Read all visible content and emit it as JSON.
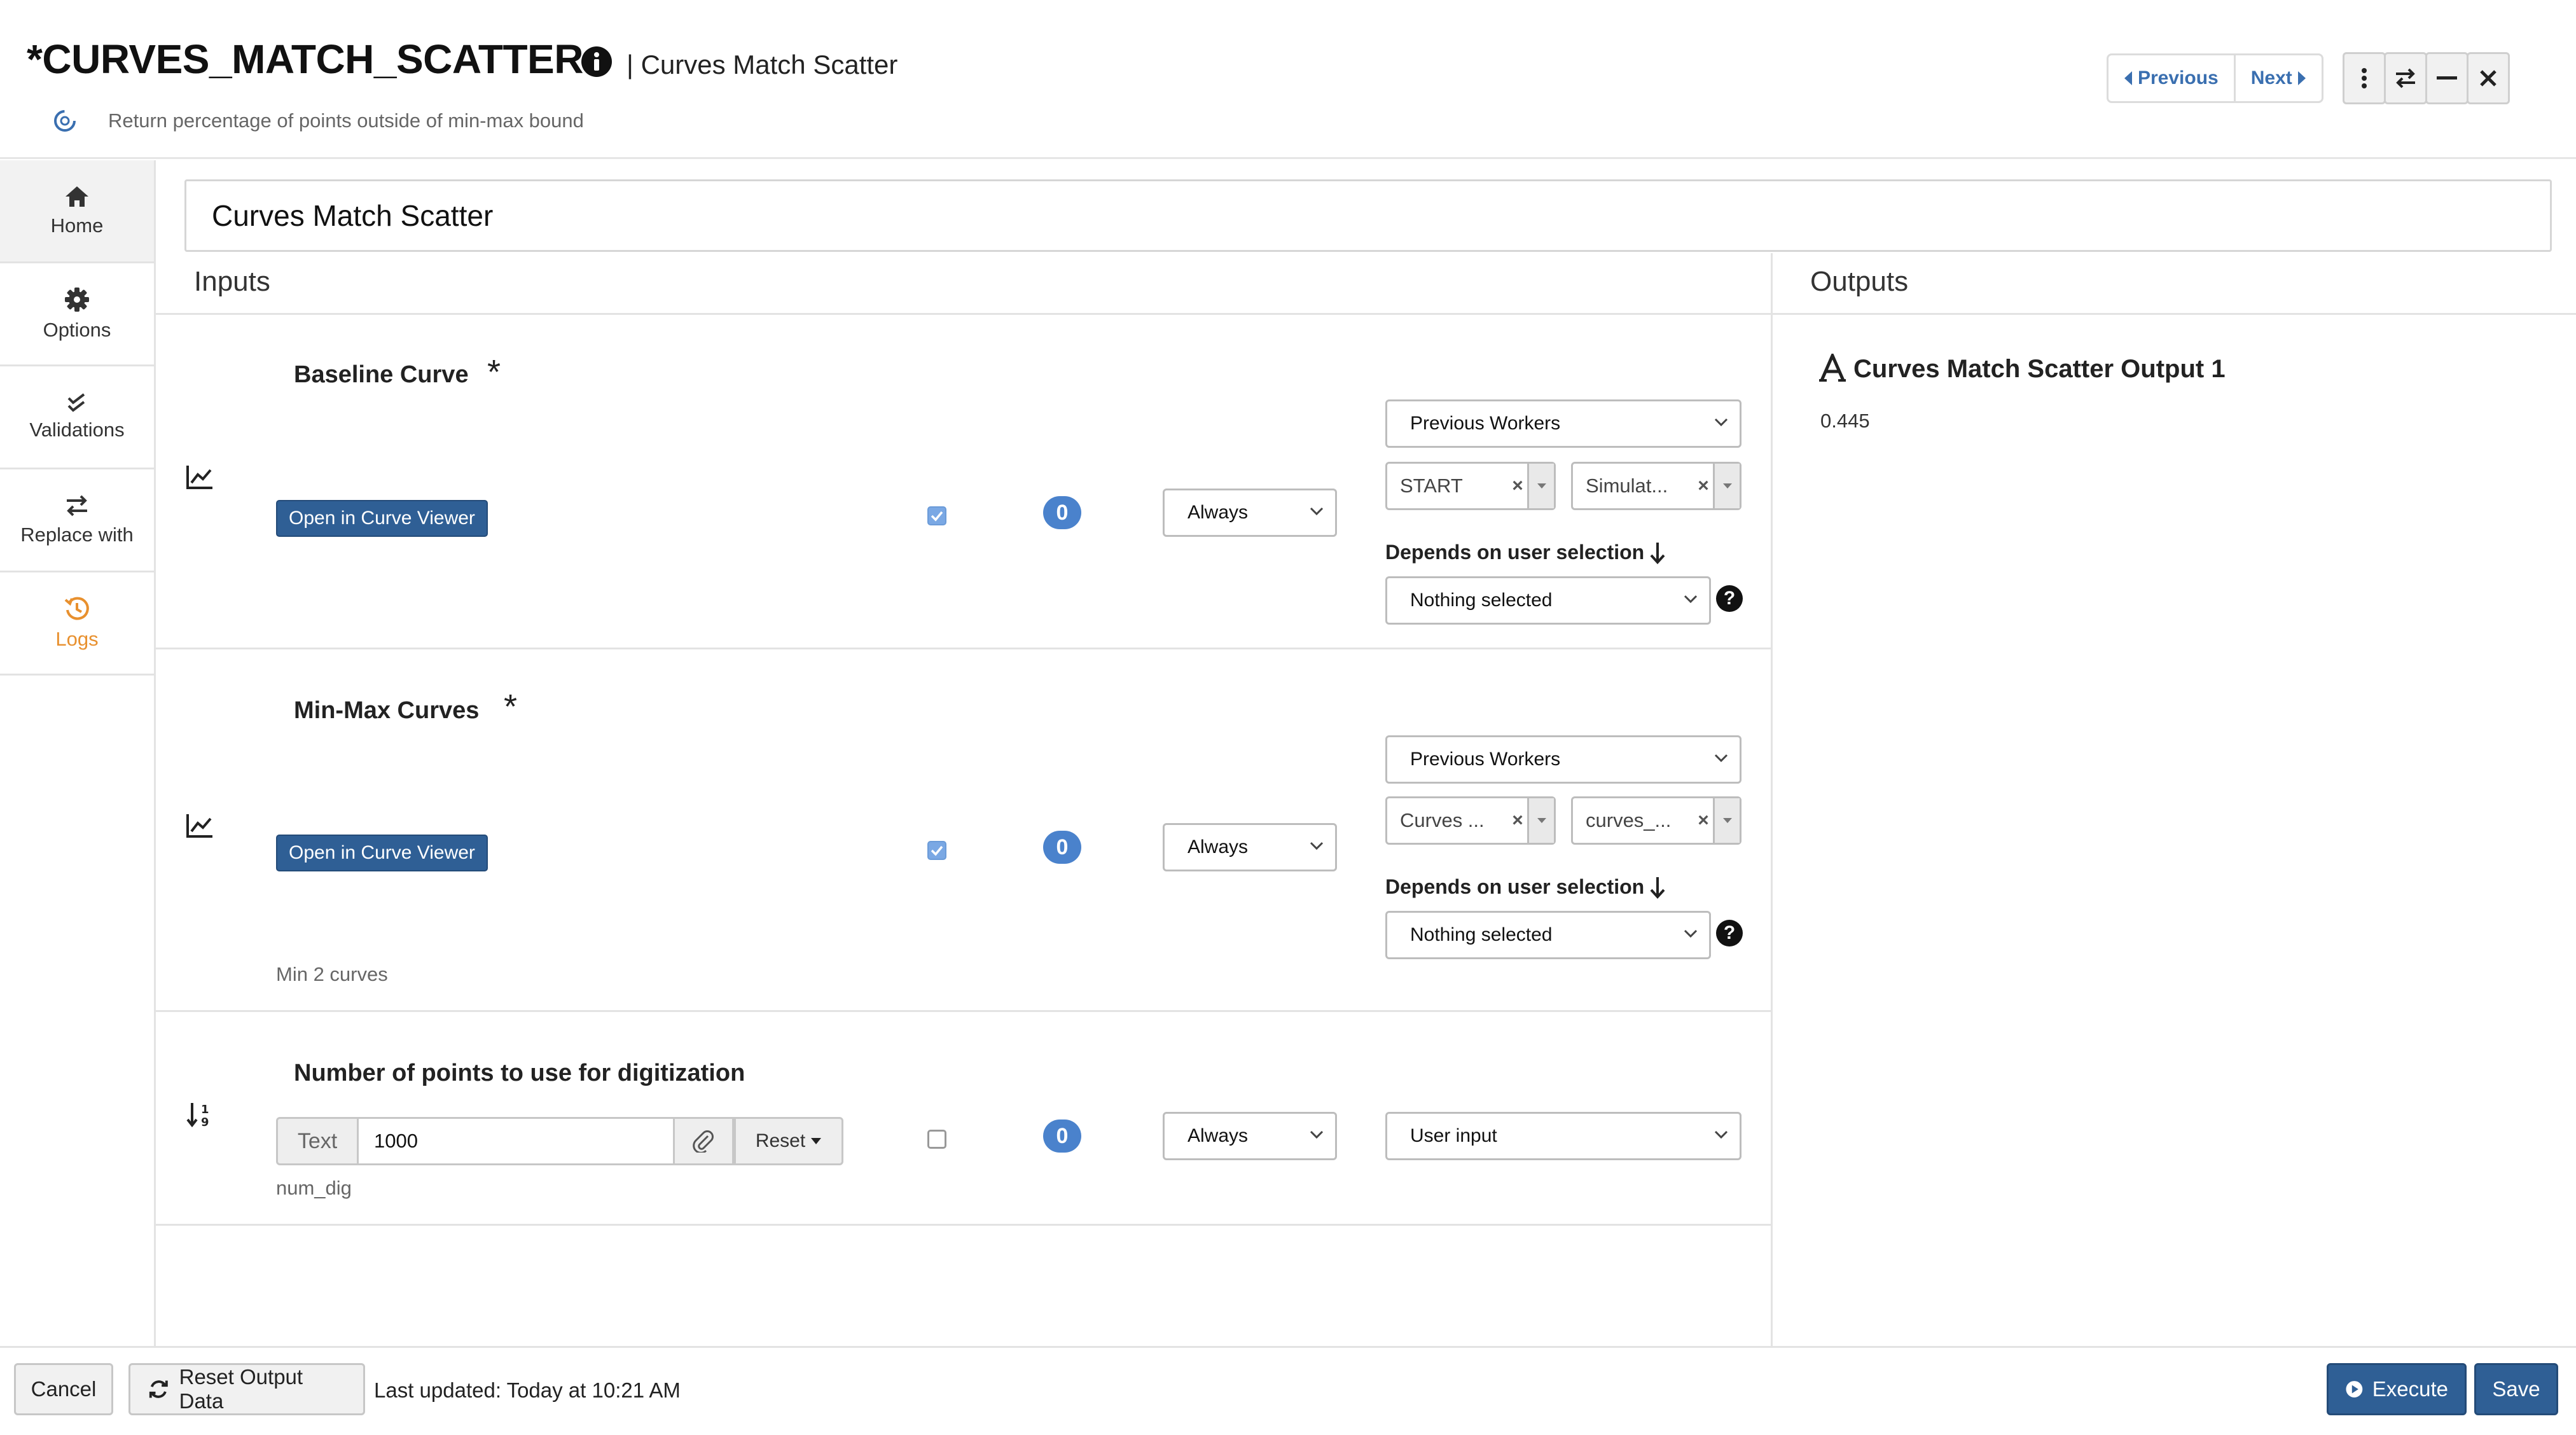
{
  "header": {
    "title": "*CURVES_MATCH_SCATTER",
    "subtitle": "| Curves Match Scatter",
    "description": "Return percentage of points outside of min-max bound",
    "nav": {
      "previous": "Previous",
      "next": "Next"
    }
  },
  "sidebar": {
    "items": [
      {
        "label": "Home",
        "icon": "home-icon"
      },
      {
        "label": "Options",
        "icon": "gear-icon"
      },
      {
        "label": "Validations",
        "icon": "check-double-icon"
      },
      {
        "label": "Replace with",
        "icon": "swap-icon"
      },
      {
        "label": "Logs",
        "icon": "history-icon"
      }
    ]
  },
  "name_field": {
    "value": "Curves Match Scatter"
  },
  "inputs": {
    "heading": "Inputs",
    "rows": [
      {
        "label": "Baseline Curve",
        "required": "*",
        "button": "Open in Curve Viewer",
        "checked": true,
        "count": "0",
        "when": "Always",
        "source": "Previous Workers",
        "tags": [
          "START",
          "Simulat..."
        ],
        "depends_label": "Depends on user selection",
        "depends_value": "Nothing selected"
      },
      {
        "label": "Min-Max Curves",
        "required": "*",
        "button": "Open in Curve Viewer",
        "hint": "Min 2 curves",
        "checked": true,
        "count": "0",
        "when": "Always",
        "source": "Previous Workers",
        "tags": [
          "Curves ...",
          "curves_..."
        ],
        "depends_label": "Depends on user selection",
        "depends_value": "Nothing selected"
      },
      {
        "label": "Number of points to use for digitization",
        "addon": "Text",
        "value": "1000",
        "reset": "Reset",
        "hint": "num_dig",
        "checked": false,
        "count": "0",
        "when": "Always",
        "source": "User input"
      }
    ]
  },
  "outputs": {
    "heading": "Outputs",
    "items": [
      {
        "label": "Curves Match Scatter Output 1",
        "value": "0.445"
      }
    ]
  },
  "footer": {
    "cancel": "Cancel",
    "reset": "Reset Output Data",
    "last_updated": "Last updated: Today at 10:21 AM",
    "execute": "Execute",
    "save": "Save"
  },
  "colors": {
    "accent": "#2f5f95",
    "badge": "#4a82cc",
    "logs": "#e8902e"
  }
}
